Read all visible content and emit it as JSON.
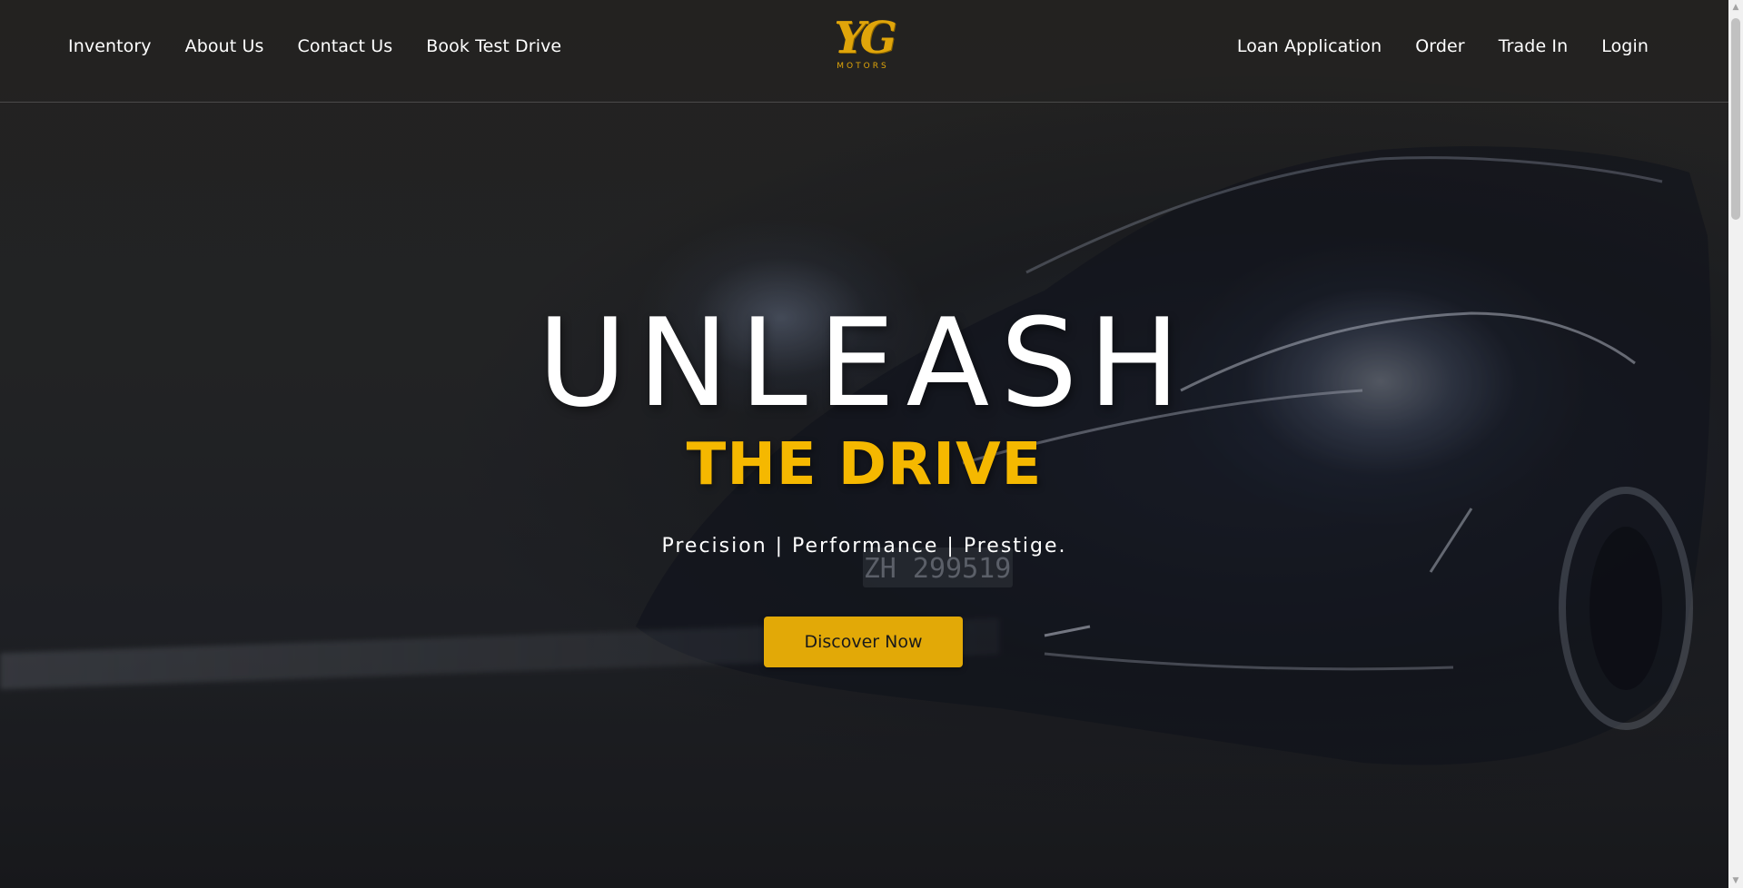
{
  "nav": {
    "left_items": [
      {
        "label": "Inventory"
      },
      {
        "label": "About Us"
      },
      {
        "label": "Contact Us"
      },
      {
        "label": "Book Test Drive"
      }
    ],
    "right_items": [
      {
        "label": "Loan Application"
      },
      {
        "label": "Order"
      },
      {
        "label": "Trade In"
      },
      {
        "label": "Login"
      }
    ]
  },
  "logo": {
    "mark": "YG",
    "text": "MOTORS"
  },
  "hero": {
    "title": "UNLEASH",
    "subtitle": "THE DRIVE",
    "tagline": "Precision | Performance | Prestige.",
    "cta_label": "Discover Now",
    "background": "car-headlight-night-image"
  },
  "colors": {
    "accent": "#e2a907",
    "subtitle": "#f5b800",
    "background": "#2a2a2c"
  },
  "icons": {
    "scroll_up": "triangle-up-icon",
    "scroll_down": "triangle-down-icon"
  }
}
